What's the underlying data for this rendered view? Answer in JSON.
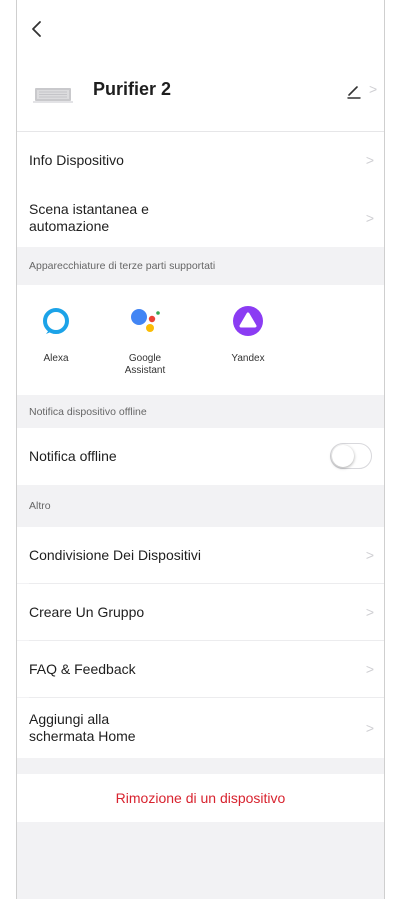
{
  "device": {
    "name": "Purifier 2"
  },
  "rows": {
    "info": "Info Dispositivo",
    "scene_line1": "Scena istantanea e",
    "scene_line2": "automazione"
  },
  "sections": {
    "third_party": "Apparecchiature di terze parti supportati",
    "offline": "Notifica dispositivo offline",
    "other": "Altro"
  },
  "assistants": [
    {
      "name": "Alexa",
      "icon": "alexa-icon"
    },
    {
      "name_line1": "Google",
      "name_line2": "Assistant",
      "icon": "google-assistant-icon"
    },
    {
      "name": "Yandex",
      "icon": "yandex-icon"
    }
  ],
  "offline_notification": {
    "label": "Notifica offline",
    "enabled": false
  },
  "other_rows": {
    "share": "Condivisione Dei Dispositivi",
    "group": "Creare Un Gruppo",
    "faq": "FAQ & Feedback",
    "home_line1": "Aggiungi alla",
    "home_line2": "schermata Home"
  },
  "remove": {
    "label": "Rimozione di un dispositivo"
  },
  "colors": {
    "danger": "#d8232f",
    "alexa": "#1ca3e8",
    "yandex": "#8b3cf3",
    "google_blue": "#4285f4",
    "google_red": "#ea4335",
    "google_yellow": "#fbbc05",
    "google_green": "#34a853"
  }
}
